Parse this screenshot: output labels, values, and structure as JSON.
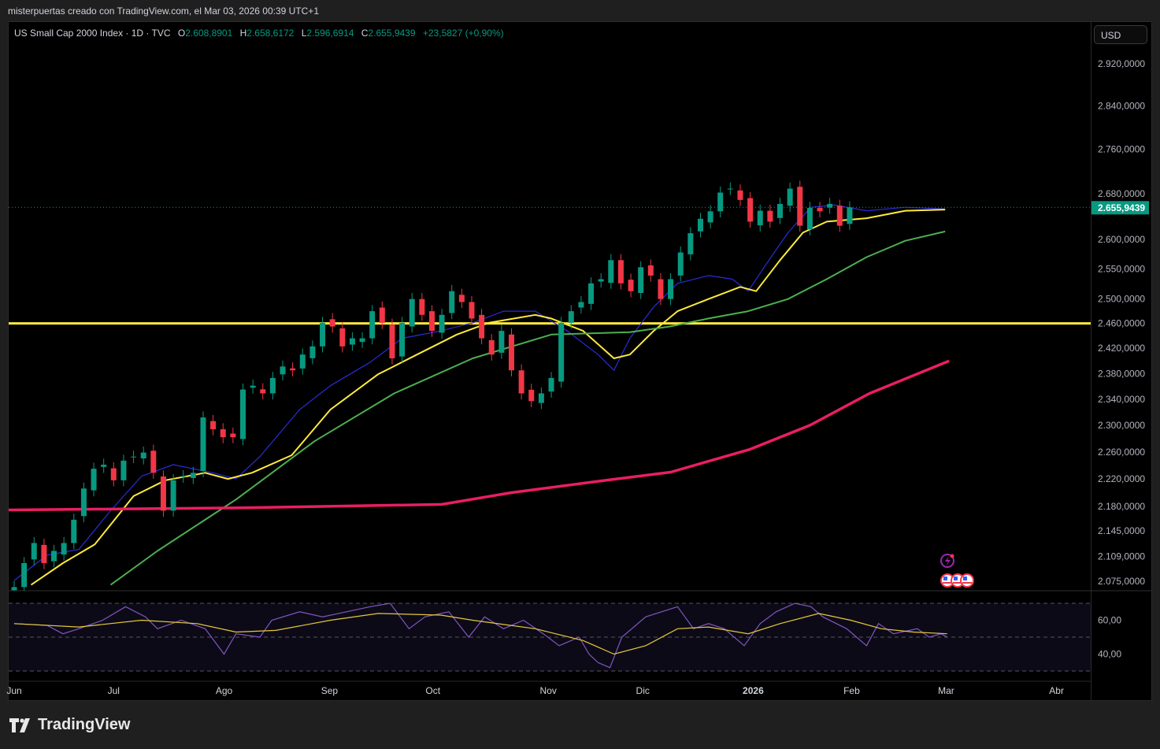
{
  "credit": "misterpuertas creado con TradingView.com, el Mar 03, 2026 00:39 UTC+1",
  "legend": {
    "symbol": "US Small Cap 2000 Index · 1D · TVC",
    "o_label": "O",
    "o": "2.608,8901",
    "h_label": "H",
    "h": "2.658,6172",
    "l_label": "L",
    "l": "2.596,6914",
    "c_label": "C",
    "c": "2.655,9439",
    "change": "+23,5827 (+0,90%)"
  },
  "currency": "USD",
  "last_price_label": "2.655,9439",
  "last_price": 2655.9439,
  "brand": "TradingView",
  "colors": {
    "up": "#089981",
    "down": "#f23645",
    "level": "#ffeb3b",
    "ma10": "#2b2bd8",
    "ma20": "#ffeb3b",
    "ma50": "#4caf50",
    "ma200": "#e91e63",
    "rsi": "#7e57c2",
    "rsi_signal": "#e5c93a"
  },
  "chart_data": {
    "type": "candlestick",
    "title": "US Small Cap 2000 Index · 1D · TVC",
    "scale": "log",
    "ylim": [
      2060,
      2960
    ],
    "y_ticks": [
      {
        "v": 2920,
        "label": "2.920,0000"
      },
      {
        "v": 2840,
        "label": "2.840,0000"
      },
      {
        "v": 2760,
        "label": "2.760,0000"
      },
      {
        "v": 2680,
        "label": "2.680,0000"
      },
      {
        "v": 2600,
        "label": "2.600,0000"
      },
      {
        "v": 2550,
        "label": "2.550,0000"
      },
      {
        "v": 2500,
        "label": "2.500,0000"
      },
      {
        "v": 2460,
        "label": "2.460,0000"
      },
      {
        "v": 2420,
        "label": "2.420,0000"
      },
      {
        "v": 2380,
        "label": "2.380,0000"
      },
      {
        "v": 2340,
        "label": "2.340,0000"
      },
      {
        "v": 2300,
        "label": "2.300,0000"
      },
      {
        "v": 2260,
        "label": "2.260,0000"
      },
      {
        "v": 2220,
        "label": "2.220,0000"
      },
      {
        "v": 2180,
        "label": "2.180,0000"
      },
      {
        "v": 2145,
        "label": "2.145,0000"
      },
      {
        "v": 2109,
        "label": "2.109,0000"
      },
      {
        "v": 2075,
        "label": "2.075,0000"
      }
    ],
    "x_ticks": [
      {
        "i": 0,
        "label": "Jun"
      },
      {
        "i": 10,
        "label": "Jul"
      },
      {
        "i": 21.1,
        "label": "Ago"
      },
      {
        "i": 31.7,
        "label": "Sep"
      },
      {
        "i": 42.1,
        "label": "Oct"
      },
      {
        "i": 53.7,
        "label": "Nov"
      },
      {
        "i": 63.2,
        "label": "Dic"
      },
      {
        "i": 74.3,
        "label": "2026",
        "bold": true
      },
      {
        "i": 84.2,
        "label": "Feb"
      },
      {
        "i": 93.7,
        "label": "Mar"
      },
      {
        "i": 104.8,
        "label": "Abr"
      }
    ],
    "closes": [
      2067,
      2100,
      2128,
      2100,
      2117,
      2128,
      2161,
      2206,
      2235,
      2241,
      2218,
      2247,
      2253,
      2259,
      2229,
      2174,
      2218,
      2224,
      2229,
      2312,
      2294,
      2282,
      2282,
      2355,
      2361,
      2349,
      2373,
      2391,
      2385,
      2410,
      2423,
      2461,
      2455,
      2423,
      2436,
      2436,
      2480,
      2461,
      2404,
      2461,
      2500,
      2474,
      2448,
      2474,
      2513,
      2495,
      2468,
      2436,
      2410,
      2448,
      2385,
      2349,
      2337,
      2349,
      2373,
      2461,
      2480,
      2495,
      2526,
      2533,
      2565,
      2526,
      2513,
      2553,
      2539,
      2500,
      2533,
      2578,
      2611,
      2636,
      2649,
      2682,
      2689,
      2669,
      2631,
      2650,
      2631,
      2662,
      2689,
      2624,
      2655,
      2649,
      2662,
      2624,
      2656
    ],
    "horizontal_level": 2460,
    "moving_averages": [
      {
        "name": "MA10",
        "color_key": "ma10",
        "points": [
          [
            0,
            2076
          ],
          [
            3.3,
            2111
          ],
          [
            6.5,
            2119
          ],
          [
            9.7,
            2174
          ],
          [
            12.8,
            2224
          ],
          [
            16,
            2241
          ],
          [
            20,
            2229
          ],
          [
            22.3,
            2220
          ],
          [
            24.7,
            2253
          ],
          [
            28.7,
            2324
          ],
          [
            31.8,
            2361
          ],
          [
            35.8,
            2398
          ],
          [
            39,
            2436
          ],
          [
            42.9,
            2448
          ],
          [
            46.1,
            2461
          ],
          [
            49.2,
            2480
          ],
          [
            52.4,
            2480
          ],
          [
            55.6,
            2448
          ],
          [
            58.7,
            2410
          ],
          [
            60.3,
            2385
          ],
          [
            61.9,
            2436
          ],
          [
            64.3,
            2487
          ],
          [
            66.7,
            2526
          ],
          [
            69.8,
            2539
          ],
          [
            72.2,
            2533
          ],
          [
            73.8,
            2513
          ],
          [
            75.4,
            2553
          ],
          [
            77.8,
            2612
          ],
          [
            80.1,
            2656
          ],
          [
            82.5,
            2660
          ],
          [
            85.7,
            2650
          ],
          [
            89.6,
            2656
          ],
          [
            93.6,
            2653
          ]
        ]
      },
      {
        "name": "MA20",
        "color_key": "ma20",
        "points": [
          [
            1.7,
            2070
          ],
          [
            4.9,
            2100
          ],
          [
            8.1,
            2126
          ],
          [
            12,
            2195
          ],
          [
            15.2,
            2218
          ],
          [
            19.2,
            2229
          ],
          [
            21.5,
            2220
          ],
          [
            23.9,
            2229
          ],
          [
            27.9,
            2255
          ],
          [
            31.8,
            2324
          ],
          [
            36.6,
            2379
          ],
          [
            40.5,
            2410
          ],
          [
            44.5,
            2442
          ],
          [
            47.7,
            2461
          ],
          [
            52.4,
            2474
          ],
          [
            54,
            2468
          ],
          [
            57.2,
            2448
          ],
          [
            60.3,
            2404
          ],
          [
            61.9,
            2410
          ],
          [
            64.3,
            2448
          ],
          [
            66.7,
            2480
          ],
          [
            69.8,
            2500
          ],
          [
            73,
            2520
          ],
          [
            74.6,
            2513
          ],
          [
            77,
            2565
          ],
          [
            79.3,
            2612
          ],
          [
            81.7,
            2631
          ],
          [
            85.7,
            2637
          ],
          [
            89.6,
            2650
          ],
          [
            93.6,
            2652
          ]
        ]
      },
      {
        "name": "MA50",
        "color_key": "ma50",
        "points": [
          [
            9.7,
            2070
          ],
          [
            14.4,
            2117
          ],
          [
            22.3,
            2190
          ],
          [
            30.2,
            2276
          ],
          [
            38.2,
            2349
          ],
          [
            46.1,
            2404
          ],
          [
            54,
            2442
          ],
          [
            61.9,
            2446
          ],
          [
            65.9,
            2455
          ],
          [
            69.8,
            2468
          ],
          [
            73.8,
            2480
          ],
          [
            77.8,
            2500
          ],
          [
            81.7,
            2533
          ],
          [
            85.7,
            2570
          ],
          [
            89.6,
            2598
          ],
          [
            93.6,
            2614
          ]
        ]
      },
      {
        "name": "MA200",
        "color_key": "ma200",
        "points": [
          [
            -0.6,
            2175
          ],
          [
            23,
            2178
          ],
          [
            43,
            2183
          ],
          [
            50,
            2200
          ],
          [
            60,
            2219
          ],
          [
            66,
            2230
          ],
          [
            74,
            2264
          ],
          [
            80,
            2300
          ],
          [
            86,
            2349
          ],
          [
            94,
            2400
          ]
        ]
      }
    ],
    "rsi": {
      "ylim": [
        20,
        80
      ],
      "bands": [
        70,
        50,
        30
      ],
      "y_ticks": [
        {
          "v": 60,
          "label": "60,00"
        },
        {
          "v": 40,
          "label": "40,00"
        }
      ],
      "values": [
        [
          0,
          58
        ],
        [
          3.3,
          57
        ],
        [
          4.9,
          52
        ],
        [
          6.5,
          55
        ],
        [
          8.9,
          60
        ],
        [
          11.2,
          68
        ],
        [
          13.2,
          62
        ],
        [
          14.4,
          55
        ],
        [
          16.8,
          60
        ],
        [
          19.2,
          55
        ],
        [
          21.1,
          40
        ],
        [
          22.3,
          52
        ],
        [
          24.7,
          50
        ],
        [
          25.9,
          60
        ],
        [
          28.7,
          65
        ],
        [
          31,
          62
        ],
        [
          33.4,
          65
        ],
        [
          35.8,
          68
        ],
        [
          37.8,
          70
        ],
        [
          39.7,
          55
        ],
        [
          41.3,
          62
        ],
        [
          43.7,
          65
        ],
        [
          45.7,
          50
        ],
        [
          47.3,
          62
        ],
        [
          49.2,
          55
        ],
        [
          51.2,
          60
        ],
        [
          53.2,
          52
        ],
        [
          54.8,
          45
        ],
        [
          56.8,
          50
        ],
        [
          57.8,
          40
        ],
        [
          58.7,
          35
        ],
        [
          59.9,
          32
        ],
        [
          61.1,
          50
        ],
        [
          63.5,
          62
        ],
        [
          66.7,
          68
        ],
        [
          68.3,
          55
        ],
        [
          69.8,
          58
        ],
        [
          71.4,
          55
        ],
        [
          73.4,
          45
        ],
        [
          75,
          58
        ],
        [
          76.6,
          65
        ],
        [
          78.5,
          70
        ],
        [
          80.1,
          68
        ],
        [
          81.3,
          62
        ],
        [
          83.7,
          55
        ],
        [
          85.7,
          45
        ],
        [
          86.9,
          58
        ],
        [
          88.4,
          52
        ],
        [
          90.8,
          55
        ],
        [
          92,
          50
        ],
        [
          93.2,
          52
        ],
        [
          93.8,
          50
        ]
      ],
      "signal": [
        [
          0,
          58
        ],
        [
          6.5,
          56
        ],
        [
          12.8,
          60
        ],
        [
          18.4,
          58
        ],
        [
          22.3,
          53
        ],
        [
          26.3,
          54
        ],
        [
          31.8,
          60
        ],
        [
          36.6,
          64
        ],
        [
          42.9,
          63
        ],
        [
          46.1,
          60
        ],
        [
          52.4,
          55
        ],
        [
          57.2,
          48
        ],
        [
          60.3,
          40
        ],
        [
          63.5,
          45
        ],
        [
          66.7,
          55
        ],
        [
          69.8,
          56
        ],
        [
          73.8,
          52
        ],
        [
          77,
          58
        ],
        [
          80.9,
          64
        ],
        [
          84.1,
          60
        ],
        [
          87.2,
          55
        ],
        [
          90.4,
          53
        ],
        [
          93.8,
          52
        ]
      ]
    }
  }
}
